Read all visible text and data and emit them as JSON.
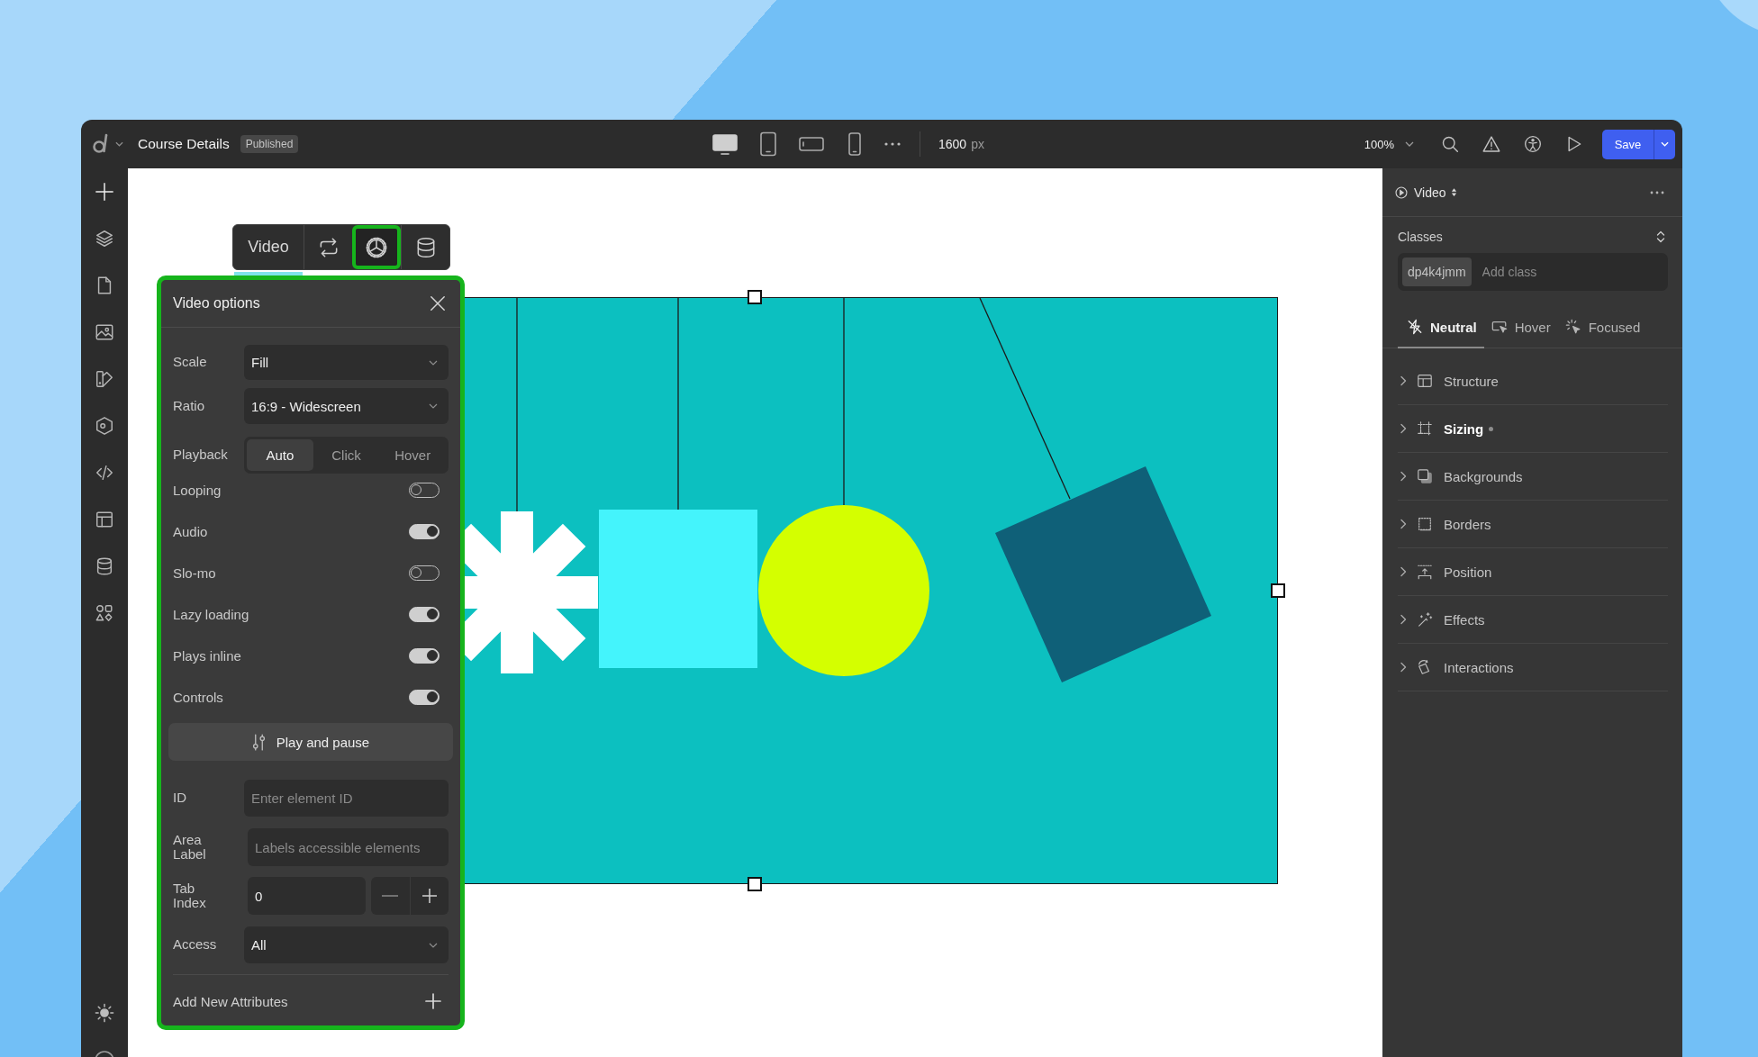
{
  "topbar": {
    "title": "Course Details",
    "status": "Published",
    "devices": [
      {
        "kind": "desktop",
        "selected": true
      },
      {
        "kind": "tablet",
        "selected": false
      },
      {
        "kind": "tablet_landscape",
        "selected": false
      },
      {
        "kind": "phone",
        "selected": false
      }
    ],
    "width_value": "1600",
    "width_unit": "px",
    "zoom": "100%",
    "save_label": "Save"
  },
  "element_toolbar": {
    "label": "Video",
    "tools": [
      {
        "kind": "sync",
        "highlighted": false
      },
      {
        "kind": "settings",
        "highlighted": true
      },
      {
        "kind": "database",
        "highlighted": false
      }
    ]
  },
  "video_options": {
    "title": "Video options",
    "highlighted": true,
    "scale": {
      "label": "Scale",
      "value": "Fill"
    },
    "ratio": {
      "label": "Ratio",
      "value": "16:9 - Widescreen"
    },
    "playback": {
      "label": "Playback",
      "options": [
        {
          "label": "Auto",
          "selected": true
        },
        {
          "label": "Click",
          "selected": false
        },
        {
          "label": "Hover",
          "selected": false
        }
      ]
    },
    "toggles": [
      {
        "label": "Looping",
        "on": false
      },
      {
        "label": "Audio",
        "on": true
      },
      {
        "label": "Slo-mo",
        "on": false
      },
      {
        "label": "Lazy loading",
        "on": true
      },
      {
        "label": "Plays inline",
        "on": true
      },
      {
        "label": "Controls",
        "on": true
      }
    ],
    "action_button": "Play and pause",
    "id_field": {
      "label": "ID",
      "placeholder": "Enter element ID"
    },
    "aria_field": {
      "label": "Area Label",
      "placeholder": "Labels accessible elements"
    },
    "tab_index": {
      "label": "Tab Index",
      "value": "0"
    },
    "access": {
      "label": "Access",
      "value": "All"
    },
    "add_attributes": "Add New Attributes"
  },
  "style_panel": {
    "element": "Video",
    "classes_label": "Classes",
    "class_chip": "dp4k4jmm",
    "class_placeholder": "Add class",
    "states": [
      {
        "kind": "neutral",
        "label": "Neutral",
        "selected": true
      },
      {
        "kind": "hover",
        "label": "Hover",
        "selected": false
      },
      {
        "kind": "focused",
        "label": "Focused",
        "selected": false
      }
    ],
    "sections": [
      {
        "kind": "structure",
        "label": "Structure",
        "expanded": false,
        "modified": false
      },
      {
        "kind": "sizing",
        "label": "Sizing",
        "expanded": false,
        "modified": true
      },
      {
        "kind": "backgrounds",
        "label": "Backgrounds",
        "expanded": false,
        "modified": false
      },
      {
        "kind": "borders",
        "label": "Borders",
        "expanded": false,
        "modified": false
      },
      {
        "kind": "position",
        "label": "Position",
        "expanded": false,
        "modified": false
      },
      {
        "kind": "effects",
        "label": "Effects",
        "expanded": false,
        "modified": false
      },
      {
        "kind": "interactions",
        "label": "Interactions",
        "expanded": false,
        "modified": false
      }
    ]
  }
}
